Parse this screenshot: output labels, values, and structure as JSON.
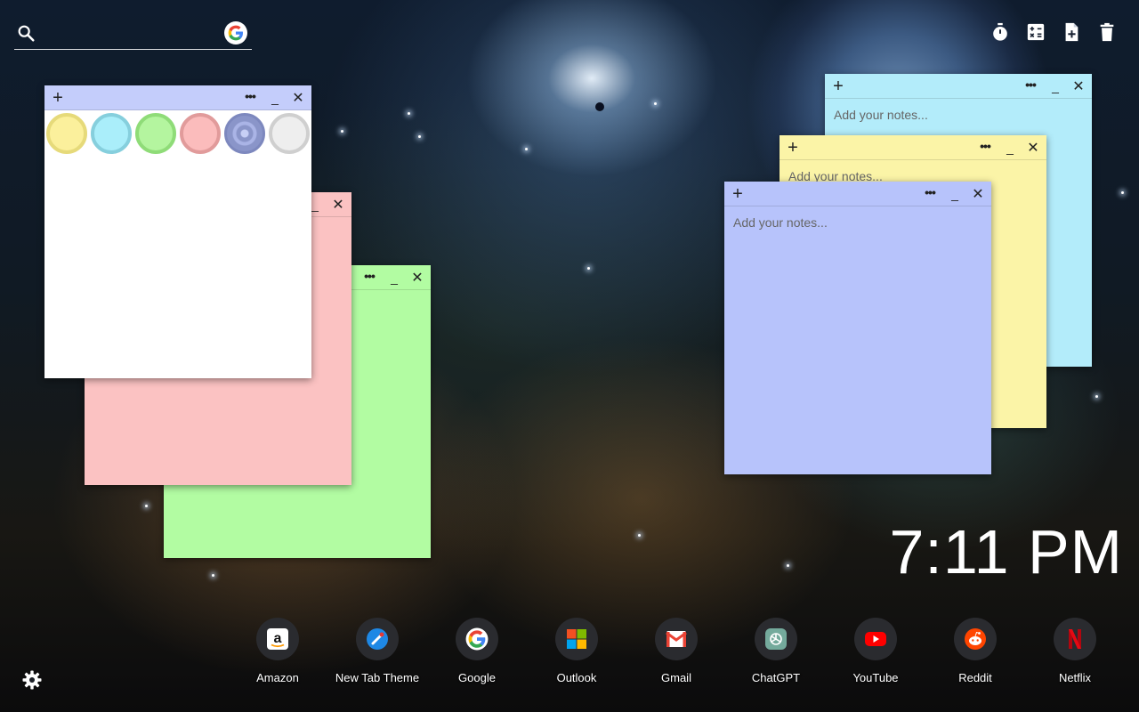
{
  "search": {
    "placeholder": "",
    "value": "",
    "engine": "google-icon"
  },
  "toolbar": {
    "icons": [
      "timer-icon",
      "calculator-icon",
      "add-note-icon",
      "trash-icon"
    ]
  },
  "notes": [
    {
      "id": "blue",
      "color": "#b3ecfa",
      "placeholder": "Add your notes..."
    },
    {
      "id": "yellow",
      "color": "#fbf4a7",
      "placeholder": "Add your notes..."
    },
    {
      "id": "lavender",
      "color": "#b7c3fb",
      "placeholder": "Add your notes..."
    },
    {
      "id": "green",
      "color": "#b2fca2",
      "placeholder": ""
    },
    {
      "id": "pink",
      "color": "#fbc2c2",
      "placeholder": ""
    },
    {
      "id": "white",
      "color": "#ffffff",
      "header_color": "#c4cdfb",
      "placeholder": ""
    }
  ],
  "color_swatches": [
    {
      "name": "yellow",
      "color": "#fbf09c"
    },
    {
      "name": "blue",
      "color": "#aaeefa"
    },
    {
      "name": "green",
      "color": "#b4f59f"
    },
    {
      "name": "pink",
      "color": "#fbbcbc"
    },
    {
      "name": "lavender",
      "color": "#8a95c9",
      "selected": true
    },
    {
      "name": "white",
      "color": "#eeeeee"
    }
  ],
  "clock": {
    "time": "7:11 PM"
  },
  "shortcuts": [
    {
      "label": "Amazon",
      "icon": "amazon-icon"
    },
    {
      "label": "New Tab Theme",
      "icon": "new-tab-theme-icon"
    },
    {
      "label": "Google",
      "icon": "google-icon"
    },
    {
      "label": "Outlook",
      "icon": "outlook-icon"
    },
    {
      "label": "Gmail",
      "icon": "gmail-icon"
    },
    {
      "label": "ChatGPT",
      "icon": "chatgpt-icon"
    },
    {
      "label": "YouTube",
      "icon": "youtube-icon"
    },
    {
      "label": "Reddit",
      "icon": "reddit-icon"
    },
    {
      "label": "Netflix",
      "icon": "netflix-icon"
    }
  ],
  "settings": {
    "icon": "gear-icon"
  }
}
